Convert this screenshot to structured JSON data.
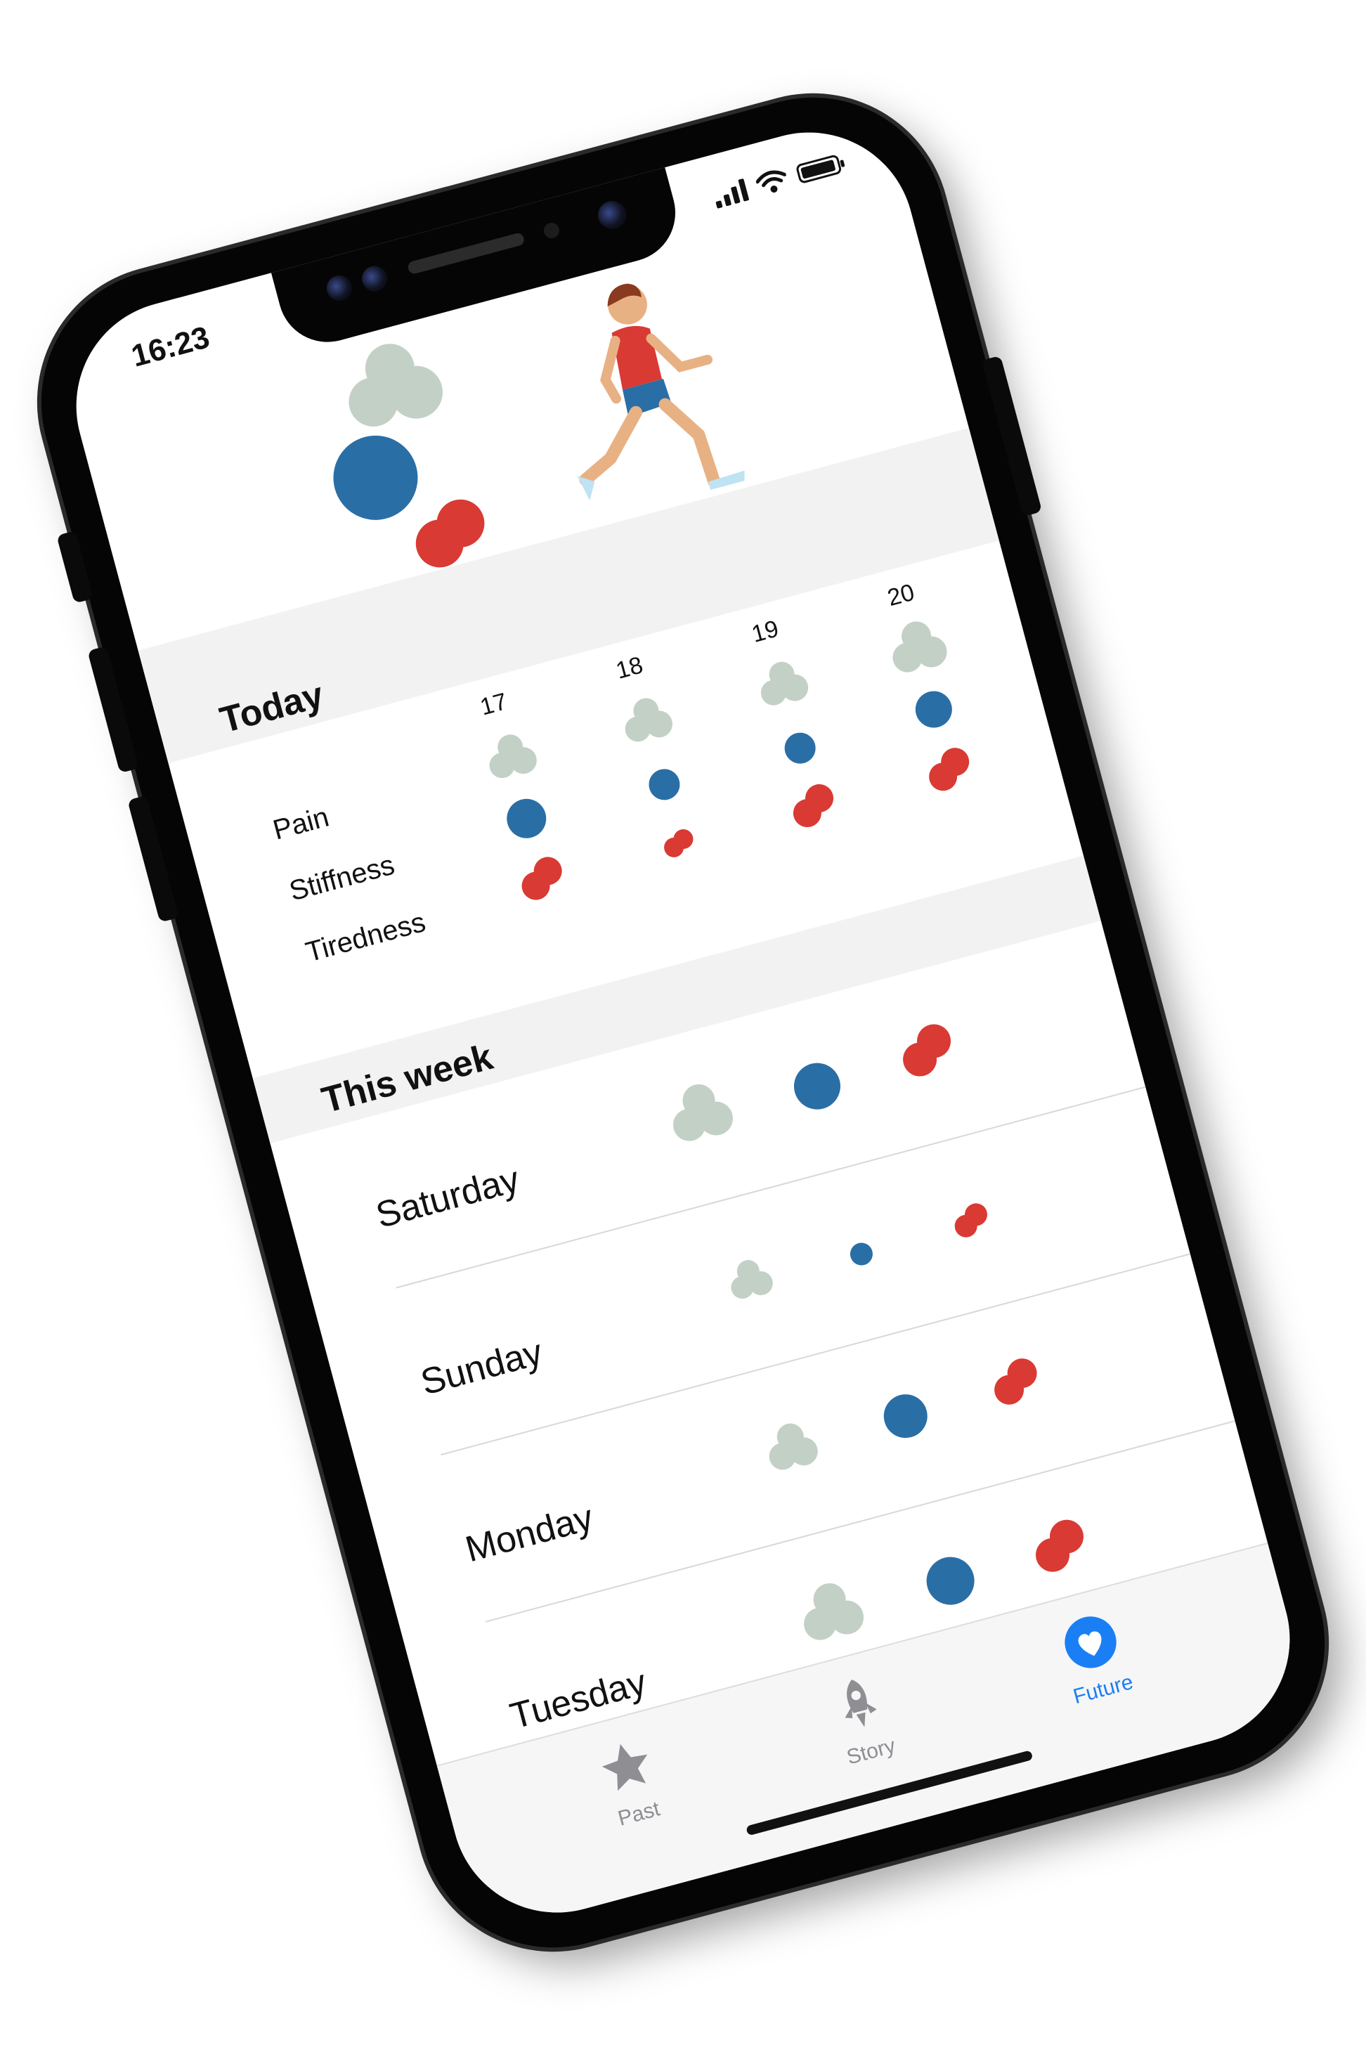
{
  "status_bar": {
    "time": "16:23"
  },
  "today": {
    "title": "Today",
    "days": [
      "17",
      "18",
      "19",
      "20"
    ],
    "metrics": [
      "Pain",
      "Stiffness",
      "Tiredness"
    ]
  },
  "week": {
    "title": "This week",
    "days": [
      {
        "name": "Saturday"
      },
      {
        "name": "Sunday"
      },
      {
        "name": "Monday"
      },
      {
        "name": "Tuesday"
      }
    ]
  },
  "tabbar": {
    "tabs": [
      {
        "label": "Past",
        "icon": "star-icon",
        "active": false
      },
      {
        "label": "Story",
        "icon": "rocket-icon",
        "active": false
      },
      {
        "label": "Future",
        "icon": "heart-icon",
        "active": true
      }
    ]
  },
  "colors": {
    "pain": "#c3d0c6",
    "stiffness": "#2a6ea6",
    "tiredness": "#d93a33",
    "accent": "#1a7ff5",
    "inactive": "#8e8e93"
  }
}
